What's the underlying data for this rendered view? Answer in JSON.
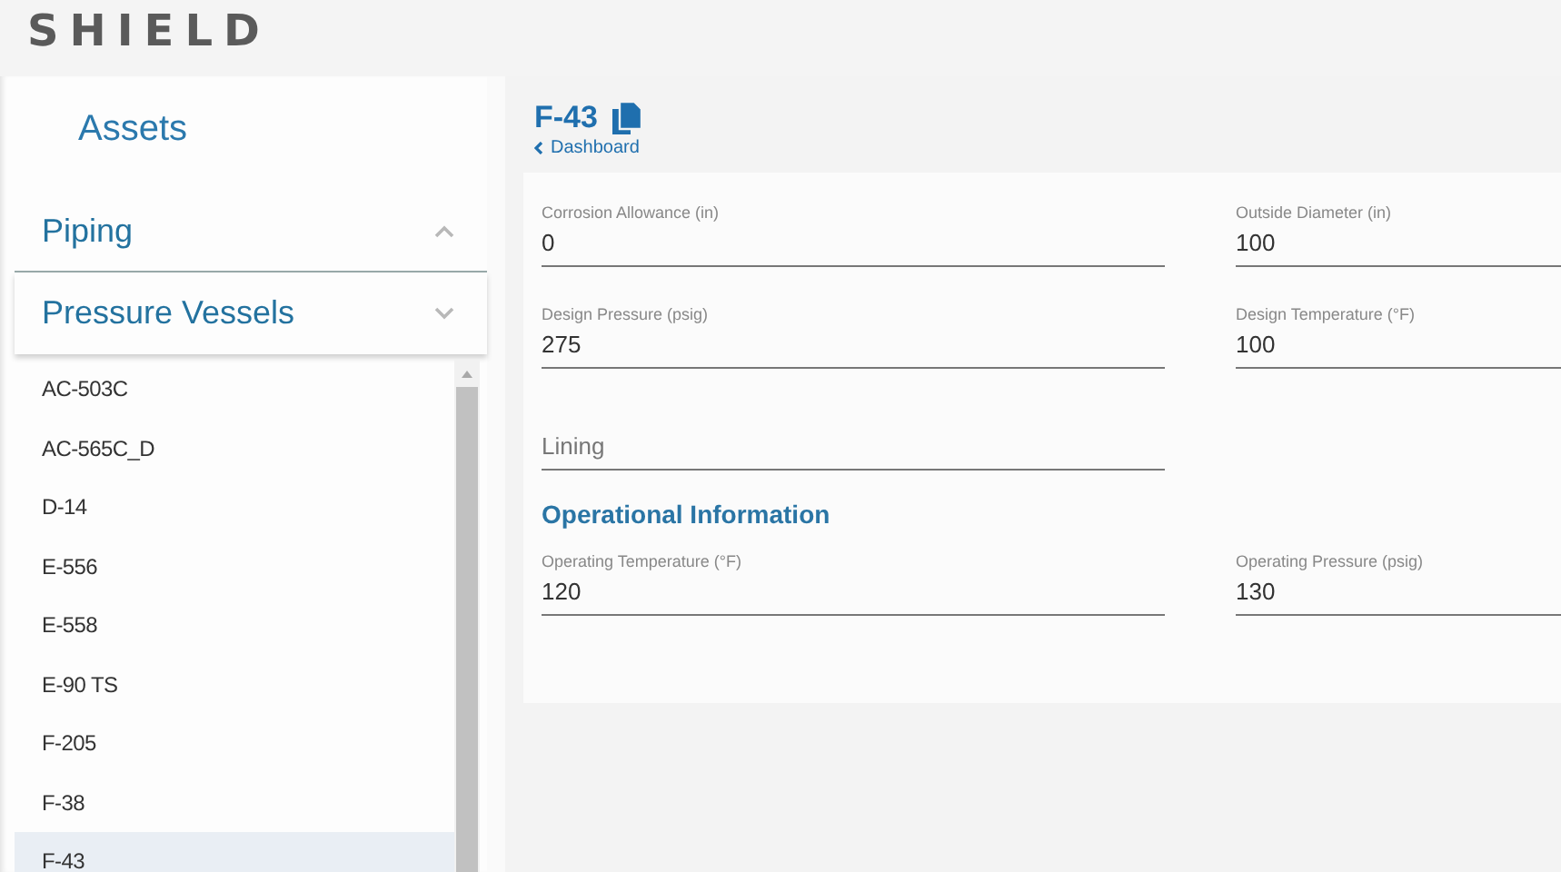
{
  "logo": "SHIELD",
  "sidebar": {
    "title": "Assets",
    "groups": [
      {
        "label": "Piping",
        "expanded": false
      },
      {
        "label": "Pressure Vessels",
        "expanded": true
      }
    ],
    "items": [
      {
        "label": "AC-503C",
        "selected": false
      },
      {
        "label": "AC-565C_D",
        "selected": false
      },
      {
        "label": "D-14",
        "selected": false
      },
      {
        "label": "E-556",
        "selected": false
      },
      {
        "label": "E-558",
        "selected": false
      },
      {
        "label": "E-90 TS",
        "selected": false
      },
      {
        "label": "F-205",
        "selected": false
      },
      {
        "label": "F-38",
        "selected": false
      },
      {
        "label": "F-43",
        "selected": true
      }
    ]
  },
  "detail": {
    "title": "F-43",
    "back_link": "Dashboard",
    "sections": [
      {
        "rows": [
          [
            {
              "label": "Corrosion Allowance (in)",
              "value": "0"
            },
            {
              "label": "Outside Diameter (in)",
              "value": "100"
            }
          ],
          [
            {
              "label": "Design Pressure (psig)",
              "value": "275"
            },
            {
              "label": "Design Temperature (°F)",
              "value": "100"
            }
          ],
          [
            {
              "placeholder": "Lining"
            }
          ]
        ]
      },
      {
        "heading": "Operational Information",
        "rows": [
          [
            {
              "label": "Operating Temperature (°F)",
              "value": "120"
            },
            {
              "label": "Operating Pressure (psig)",
              "value": "130"
            }
          ]
        ]
      }
    ]
  }
}
